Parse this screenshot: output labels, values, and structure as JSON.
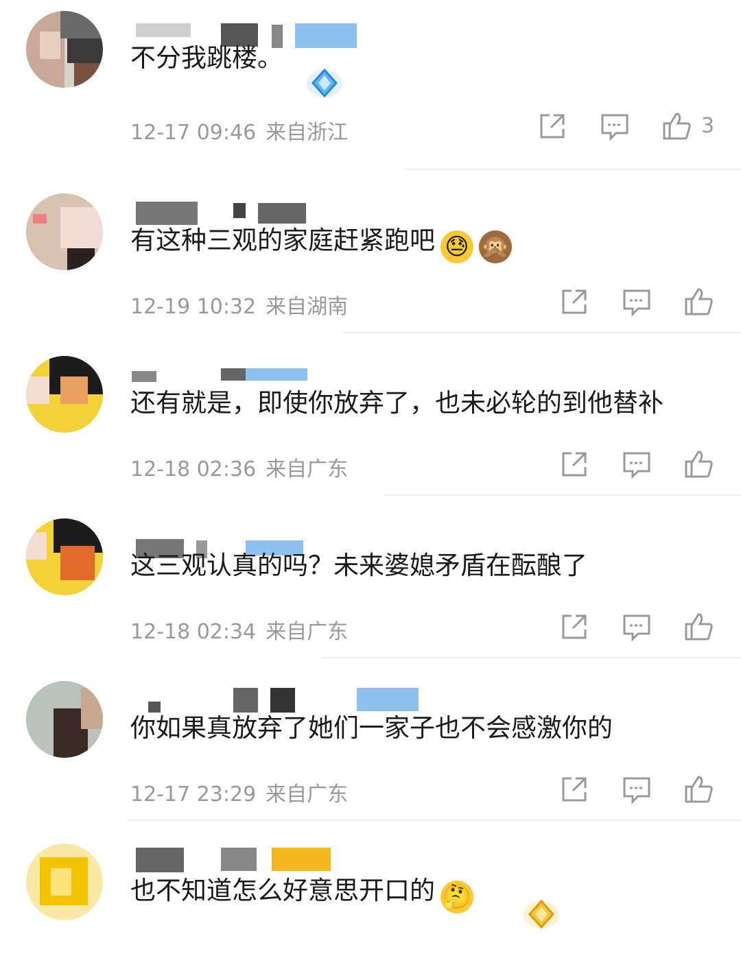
{
  "comments": [
    {
      "text": "不分我跳楼。",
      "time": "12-17 09:46",
      "location": "来自浙江",
      "likes": "3",
      "emoji": [],
      "badge": "blue"
    },
    {
      "text": "有这种三观的家庭赶紧跑吧",
      "time": "12-19 10:32",
      "location": "来自湖南",
      "likes": "",
      "emoji": [
        "😓",
        "🙊"
      ],
      "badge": ""
    },
    {
      "text": "还有就是，即使你放弃了，也未必轮的到他替补",
      "time": "12-18 02:36",
      "location": "来自广东",
      "likes": "",
      "emoji": [],
      "badge": ""
    },
    {
      "text": "这三观认真的吗？未来婆媳矛盾在酝酿了",
      "time": "12-18 02:34",
      "location": "来自广东",
      "likes": "",
      "emoji": [],
      "badge": ""
    },
    {
      "text": "你如果真放弃了她们一家子也不会感激你的",
      "time": "12-17 23:29",
      "location": "来自广东",
      "likes": "",
      "emoji": [],
      "badge": ""
    },
    {
      "text": "也不知道怎么好意思开口的",
      "time": "",
      "location": "",
      "likes": "",
      "emoji": [
        "🤔"
      ],
      "badge": "gold"
    }
  ],
  "icons": {
    "share": "share-icon",
    "reply": "comment-icon",
    "like": "thumbs-up-icon"
  },
  "colors": {
    "meta": "#999999",
    "divider": "#eeeeee",
    "badge_blue": "#4aa8f0",
    "badge_gold": "#f5b820"
  }
}
